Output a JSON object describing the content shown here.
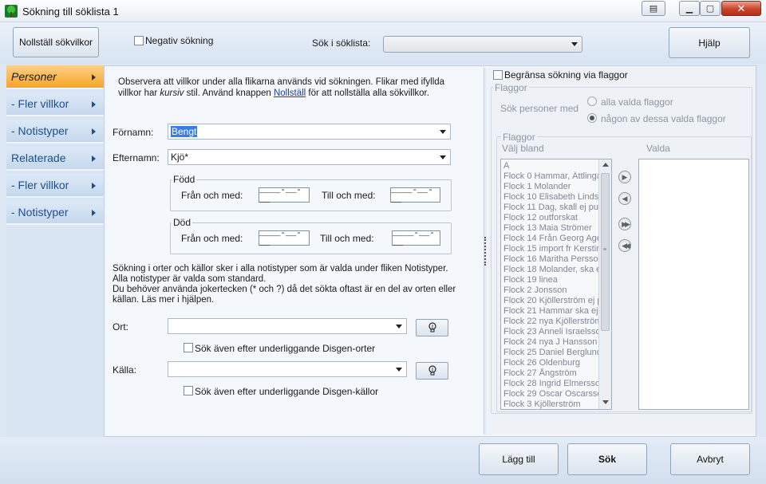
{
  "window": {
    "title": "Sökning till söklista 1"
  },
  "toolbar": {
    "reset_label": "Nollställ sökvilkor",
    "negative_label": "Negativ sökning",
    "search_list_label": "Sök i söklista:",
    "search_list_value": "",
    "help_label": "Hjälp"
  },
  "sidebar": {
    "items": [
      {
        "label": "Personer"
      },
      {
        "label": "- Fler villkor"
      },
      {
        "label": "- Notistyper"
      },
      {
        "label": "Relaterade"
      },
      {
        "label": "- Fler villkor"
      },
      {
        "label": "- Notistyper"
      }
    ]
  },
  "form": {
    "info_1": "Observera att villkor under alla flikarna används vid sökningen. Flikar med ifyllda",
    "info_2a": "villkor har ",
    "info_2b": "kursiv",
    "info_2c": " stil. Använd knappen ",
    "info_2d": "Nollställ",
    "info_2e": " för att nollställa alla sökvillkor.",
    "firstname_label": "Förnamn:",
    "firstname_value": "Bengt",
    "lastname_label": "Efternamn:",
    "lastname_value": "Kjö*",
    "born_title": "Född",
    "died_title": "Död",
    "from_label": "Från och med:",
    "to_label": "Till och med:",
    "date_mask": "____-__-__",
    "note_1": "Sökning i orter och källor sker i alla notistyper som är valda under fliken Notistyper.",
    "note_2": "Alla notistyper är valda som standard.",
    "note_3": "Du behöver använda jokertecken (* och ?) då det sökta oftast är en del av orten eller",
    "note_4": "källan. Läs mer i hjälpen.",
    "place_label": "Ort:",
    "place_value": "",
    "place_sub_label": "Sök även efter underliggande Disgen-orter",
    "source_label": "Källa:",
    "source_value": "",
    "source_sub_label": "Sök även efter underliggande Disgen-källor"
  },
  "flags": {
    "limit_label": "Begränsa sökning via flaggor",
    "group_title": "Flaggor",
    "search_persons_label": "Sök personer med",
    "radio_all": "alla valda flaggor",
    "radio_any": "någon av dessa valda flaggor",
    "inner_title": "Flaggor",
    "choose_label": "Välj bland",
    "selected_label": "Valda",
    "items": [
      "A",
      "Flock 0 Hammar, Ättlinga",
      "Flock 1 Molander",
      "Flock 10 Elisabeth Lindsk",
      "Flock 11 Dag, skall ej pul",
      "Flock 12 outforskat",
      "Flock 13 Maia Strömer",
      "Flock 14 Från Georg Age",
      "Flock 15 import fr Kerstin",
      "Flock 16 Maritha Persson",
      "Flock 18 Molander, ska e",
      "Flock 19 linea",
      "Flock 2 Jonsson",
      "Flock 20 Kjöllerström ej p",
      "Flock 21 Hammar ska ej p",
      "Flock 22 nya Kjöllerström",
      "Flock 23 Anneli Israelsso",
      "Flock 24 nya J Hansson",
      "Flock 25 Daniel Berglund",
      "Flock 26 Oldenburg",
      "Flock 27 Ångström",
      "Flock 28 Ingrid Elmersso",
      "Flock 29 Oscar Oscarsso",
      "Flock 3 Kjöllerström"
    ]
  },
  "footer": {
    "add_label": "Lägg till",
    "search_label": "Sök",
    "cancel_label": "Avbryt"
  },
  "colors": {
    "active_tab": "#f7a526",
    "link": "#1a3e9a"
  }
}
